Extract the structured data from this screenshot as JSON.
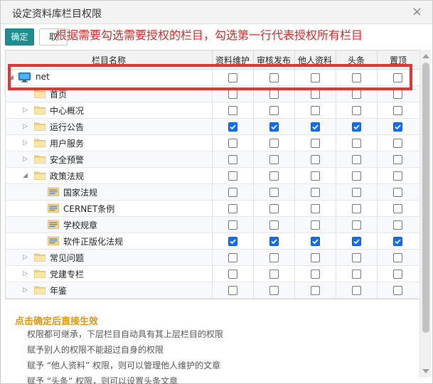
{
  "dialog": {
    "title": "设定资料库栏目权限",
    "close_glyph": "×"
  },
  "toolbar": {
    "ok_label": "确定",
    "cancel_label": "取"
  },
  "annotation": {
    "text": "根据需要勾选需要授权的栏目，勾选第一行代表授权所有栏目",
    "color": "#e53333"
  },
  "grid": {
    "columns": [
      "栏目名称",
      "资料维护",
      "审核发布",
      "他人资料",
      "头条",
      "置顶"
    ],
    "rows": [
      {
        "label": "net",
        "level": 0,
        "toggle": "◢",
        "icon": "monitor-icon",
        "checks": [
          false,
          false,
          false,
          false,
          false
        ]
      },
      {
        "label": "首页",
        "level": 1,
        "toggle": "",
        "icon": "folder-icon",
        "checks": [
          false,
          false,
          false,
          false,
          false
        ]
      },
      {
        "label": "中心概况",
        "level": 1,
        "toggle": "▷",
        "icon": "folder-icon",
        "checks": [
          false,
          false,
          false,
          false,
          false
        ]
      },
      {
        "label": "运行公告",
        "level": 1,
        "toggle": "▷",
        "icon": "folder-icon",
        "checks": [
          true,
          true,
          true,
          true,
          true
        ]
      },
      {
        "label": "用户服务",
        "level": 1,
        "toggle": "▷",
        "icon": "folder-icon",
        "checks": [
          false,
          false,
          false,
          false,
          false
        ]
      },
      {
        "label": "安全预警",
        "level": 1,
        "toggle": "▷",
        "icon": "folder-icon",
        "checks": [
          false,
          false,
          false,
          false,
          false
        ]
      },
      {
        "label": "政策法规",
        "level": 1,
        "toggle": "◢",
        "icon": "folder-icon",
        "checks": [
          false,
          false,
          false,
          false,
          false
        ]
      },
      {
        "label": "国家法规",
        "level": 2,
        "toggle": "",
        "icon": "file-folder-icon",
        "checks": [
          false,
          false,
          false,
          false,
          false
        ]
      },
      {
        "label": "CERNET条例",
        "level": 2,
        "toggle": "",
        "icon": "file-folder-icon",
        "checks": [
          false,
          false,
          false,
          false,
          false
        ]
      },
      {
        "label": "学校规章",
        "level": 2,
        "toggle": "",
        "icon": "file-folder-icon",
        "checks": [
          false,
          false,
          false,
          false,
          false
        ]
      },
      {
        "label": "软件正版化法规",
        "level": 2,
        "toggle": "",
        "icon": "file-folder-icon",
        "checks": [
          true,
          true,
          true,
          true,
          true
        ]
      },
      {
        "label": "常见问题",
        "level": 1,
        "toggle": "▷",
        "icon": "folder-icon",
        "checks": [
          false,
          false,
          false,
          false,
          false
        ]
      },
      {
        "label": "党建专栏",
        "level": 1,
        "toggle": "▷",
        "icon": "folder-icon",
        "checks": [
          false,
          false,
          false,
          false,
          false
        ]
      },
      {
        "label": "年鉴",
        "level": 1,
        "toggle": "▷",
        "icon": "folder-icon",
        "checks": [
          false,
          false,
          false,
          false,
          false
        ]
      }
    ]
  },
  "notes": {
    "title": "点击确定后直接生效",
    "items": [
      "权限都可继承，下层栏目自动具有其上层栏目的权限",
      "赋予别人的权限不能超过自身的权限",
      "赋予 “他人资料” 权限，则可以管理他人维护的文章",
      "赋予 “头条” 权限，则可以设置头条文章"
    ]
  },
  "colors": {
    "accent": "#1c8f91",
    "checkbox_on": "#0d6efd",
    "notes_title": "#e8940a",
    "folder": "#f5d78a"
  }
}
